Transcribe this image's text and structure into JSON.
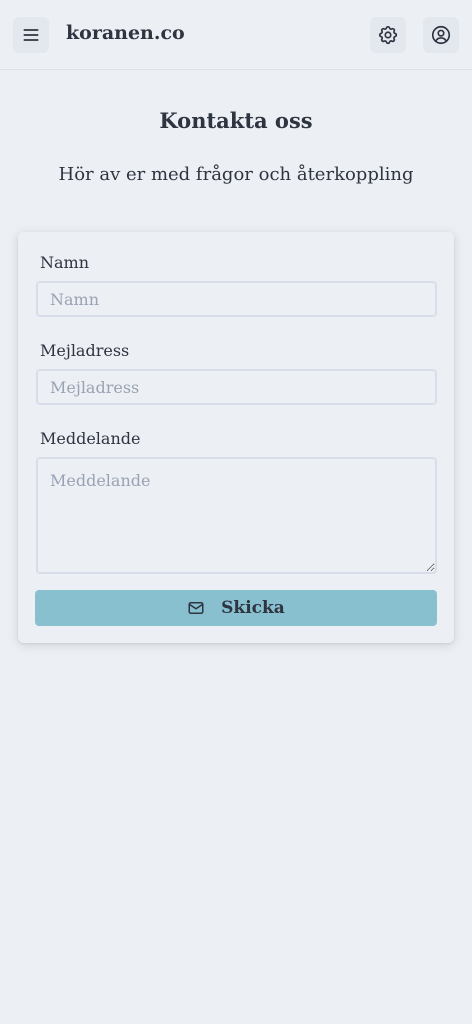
{
  "header": {
    "brand": "koranen.co",
    "menu_icon": "hamburger-menu-icon",
    "settings_icon": "gear-icon",
    "account_icon": "user-circle-icon"
  },
  "page": {
    "title": "Kontakta oss",
    "subtitle": "Hör av er med frågor och återkoppling"
  },
  "form": {
    "name": {
      "label": "Namn",
      "placeholder": "Namn",
      "value": ""
    },
    "email": {
      "label": "Mejladress",
      "placeholder": "Mejladress",
      "value": ""
    },
    "message": {
      "label": "Meddelande",
      "placeholder": "Meddelande",
      "value": ""
    },
    "submit": {
      "label": "Skicka",
      "icon": "mail-icon"
    }
  },
  "colors": {
    "background": "#eceff4",
    "text": "#2e3440",
    "accent": "#88c0d0",
    "border": "#d8dee9"
  }
}
